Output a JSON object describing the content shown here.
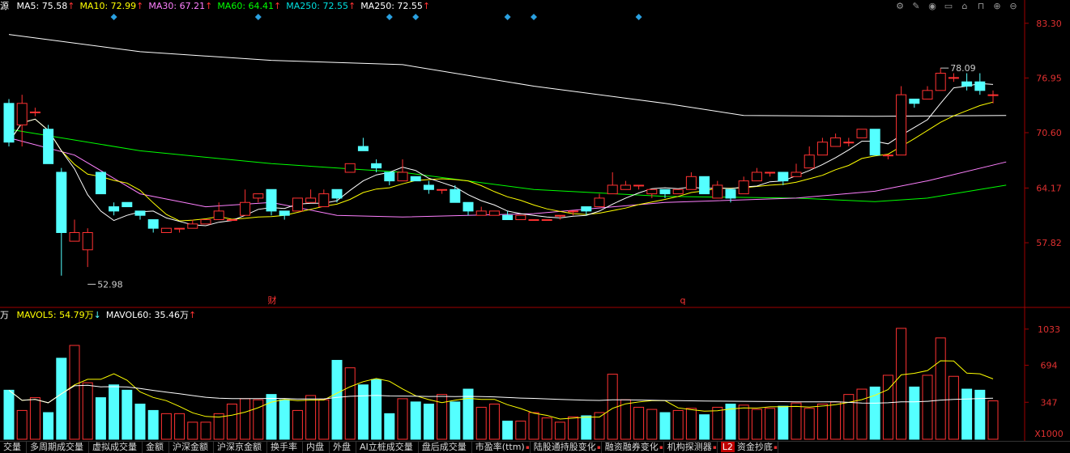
{
  "legend": {
    "name": "源",
    "items": [
      {
        "label": "MA5: 75.58",
        "arrow": "↑",
        "color": "#ffffff"
      },
      {
        "label": "MA10: 72.99",
        "arrow": "↑",
        "color": "#ffff00"
      },
      {
        "label": "MA30: 67.21",
        "arrow": "↑",
        "color": "#ff80ff"
      },
      {
        "label": "MA60: 64.41",
        "arrow": "↑",
        "color": "#00ff00"
      },
      {
        "label": "MA250: 72.55",
        "arrow": "↑",
        "color": "#00e0e0"
      },
      {
        "label": "MA250: 72.55",
        "arrow": "↑",
        "color": "#ffffff"
      }
    ]
  },
  "vol_legend": {
    "unit": "万",
    "items": [
      {
        "label": "MAVOL5: 54.79万",
        "arrow": "↓",
        "color": "#ffff00"
      },
      {
        "label": "MAVOL60: 35.46万",
        "arrow": "↑",
        "color": "#ffffff"
      }
    ]
  },
  "toolbar_icons": [
    "settings-icon",
    "pen-icon",
    "eye-icon",
    "basket-icon",
    "home-icon",
    "lock-icon",
    "plus-icon",
    "minus-icon"
  ],
  "price_axis": [
    "83.30",
    "76.95",
    "70.60",
    "64.17",
    "57.82"
  ],
  "vol_axis": [
    "1033",
    "694",
    "347",
    "X1000"
  ],
  "annotations": {
    "high": "78.09",
    "low": "52.98",
    "marker_cai": "财",
    "marker_q": "q"
  },
  "tabs": [
    {
      "label": "交量",
      "mark": false
    },
    {
      "label": "多周期成交量",
      "mark": false
    },
    {
      "label": "虚拟成交量",
      "mark": false
    },
    {
      "label": "金额",
      "mark": false
    },
    {
      "label": "沪深金额",
      "mark": false
    },
    {
      "label": "沪深京金额",
      "mark": false
    },
    {
      "label": "换手率",
      "mark": false
    },
    {
      "label": "内盘",
      "mark": false
    },
    {
      "label": "外盘",
      "mark": false
    },
    {
      "label": "AI立桩成交量",
      "mark": false
    },
    {
      "label": "盘后成交量",
      "mark": false
    },
    {
      "label": "市盈率(ttm)",
      "mark": true
    },
    {
      "label": "陆股通持股变化",
      "mark": true
    },
    {
      "label": "融资融券变化",
      "mark": true
    },
    {
      "label": "机构探测器",
      "mark": true
    },
    {
      "label": "资金抄底",
      "mark": true,
      "badge": "L2"
    }
  ],
  "colors": {
    "up": "#ff3232",
    "down": "#54ffff",
    "axis": "#a00000"
  },
  "chart_data": {
    "type": "candlestick",
    "price_range": [
      50.5,
      84.5
    ],
    "volume_range": [
      0,
      1100
    ],
    "candles": [
      [
        74,
        69.5,
        74.5,
        69
      ],
      [
        71.5,
        74,
        75,
        69
      ],
      [
        73,
        73,
        73.5,
        72.5
      ],
      [
        71,
        67,
        71.5,
        67
      ],
      [
        66,
        59,
        66.5,
        54
      ],
      [
        58,
        59,
        60.5,
        58
      ],
      [
        57,
        59,
        59.5,
        55
      ],
      [
        66,
        63.5,
        66,
        63.5
      ],
      [
        62,
        61.5,
        62.5,
        61
      ],
      [
        62.5,
        62,
        62.5,
        62
      ],
      [
        61.5,
        61,
        61.5,
        60.5
      ],
      [
        60.5,
        59.5,
        60.5,
        59
      ],
      [
        59,
        59.5,
        59.5,
        59
      ],
      [
        59.5,
        59.5,
        59.5,
        59
      ],
      [
        59.5,
        60,
        60.5,
        59.5
      ],
      [
        60,
        60.5,
        60.5,
        60
      ],
      [
        60.5,
        61.5,
        62.5,
        60.5
      ],
      [
        60.5,
        60.5,
        60.5,
        60.5
      ],
      [
        61,
        62.5,
        64,
        61
      ],
      [
        63,
        63.5,
        63.5,
        62.5
      ],
      [
        64,
        61.5,
        64,
        61
      ],
      [
        61.5,
        61,
        61.5,
        60.5
      ],
      [
        61.5,
        63,
        63,
        61.5
      ],
      [
        62.5,
        63,
        64,
        62.5
      ],
      [
        62,
        63.5,
        64,
        62
      ],
      [
        64,
        63,
        64,
        62.5
      ],
      [
        66,
        67,
        67,
        66
      ],
      [
        69,
        68.5,
        70,
        68.5
      ],
      [
        67,
        66.5,
        67.5,
        66
      ],
      [
        66,
        65,
        66,
        64.5
      ],
      [
        65,
        66,
        67.5,
        65
      ],
      [
        65.5,
        65,
        65.5,
        65
      ],
      [
        64.5,
        64,
        65,
        63.5
      ],
      [
        64,
        64,
        64,
        63.5
      ],
      [
        64,
        62.5,
        64.5,
        62.5
      ],
      [
        62.5,
        61.5,
        62.5,
        61
      ],
      [
        61,
        61.5,
        62,
        61
      ],
      [
        61,
        61.5,
        61.5,
        61
      ],
      [
        61,
        60.5,
        61.5,
        60.5
      ],
      [
        60.5,
        61,
        61,
        60.5
      ],
      [
        60.5,
        60.5,
        60.5,
        60.5
      ],
      [
        60.5,
        60.5,
        60.5,
        60.5
      ],
      [
        61,
        61,
        61,
        60.5
      ],
      [
        61.5,
        61.5,
        61.5,
        61
      ],
      [
        62,
        61.5,
        62,
        61
      ],
      [
        62,
        63,
        63.5,
        62
      ],
      [
        63.5,
        64.5,
        66,
        63.5
      ],
      [
        64,
        64.5,
        65,
        64
      ],
      [
        64.5,
        64.5,
        64.5,
        64
      ],
      [
        63.5,
        64,
        64,
        63
      ],
      [
        64,
        63.5,
        64,
        63
      ],
      [
        63.5,
        64,
        64,
        63.5
      ],
      [
        64,
        65.5,
        66,
        64
      ],
      [
        65.5,
        63.5,
        65.5,
        63.5
      ],
      [
        63,
        64.5,
        65,
        63
      ],
      [
        64,
        63,
        64,
        62.5
      ],
      [
        63.5,
        65,
        65.5,
        63.5
      ],
      [
        65,
        66,
        66.5,
        65
      ],
      [
        66,
        66,
        66,
        65.5
      ],
      [
        66,
        65,
        66,
        64.5
      ],
      [
        65.5,
        66,
        67,
        65.5
      ],
      [
        66.5,
        68,
        69,
        66.5
      ],
      [
        68,
        69.5,
        70,
        68
      ],
      [
        69,
        70,
        70.5,
        69
      ],
      [
        69.5,
        69.5,
        70,
        69
      ],
      [
        70,
        71,
        71,
        70
      ],
      [
        71,
        68,
        71,
        68
      ],
      [
        68,
        68,
        68,
        67.5
      ],
      [
        68,
        75,
        76,
        68
      ],
      [
        74.5,
        74,
        74.5,
        73.5
      ],
      [
        74.5,
        75.5,
        76,
        74.5
      ],
      [
        75.5,
        77.5,
        78.1,
        75.5
      ],
      [
        77,
        77,
        77.5,
        76.5
      ],
      [
        76.5,
        76,
        77.5,
        75.5
      ],
      [
        76.5,
        75.5,
        77.5,
        75
      ],
      [
        75,
        75,
        75.5,
        74
      ]
    ],
    "volumes": [
      460,
      270,
      390,
      250,
      760,
      880,
      530,
      390,
      510,
      460,
      330,
      270,
      240,
      240,
      160,
      160,
      240,
      330,
      380,
      370,
      420,
      370,
      270,
      410,
      370,
      740,
      670,
      510,
      560,
      240,
      380,
      350,
      330,
      420,
      350,
      470,
      300,
      330,
      170,
      170,
      250,
      200,
      160,
      210,
      220,
      250,
      610,
      370,
      300,
      280,
      250,
      270,
      290,
      230,
      300,
      330,
      320,
      280,
      290,
      310,
      340,
      290,
      330,
      350,
      420,
      470,
      490,
      600,
      1040,
      490,
      600,
      950,
      590,
      470,
      460,
      360
    ],
    "series": [
      {
        "name": "MA5",
        "color": "#ffffff"
      },
      {
        "name": "MA10",
        "color": "#ffff00"
      },
      {
        "name": "MA30",
        "color": "#ff80ff"
      },
      {
        "name": "MA60",
        "color": "#00ff00"
      },
      {
        "name": "MA250",
        "color": "#ffffff"
      }
    ],
    "ma250_line": [
      [
        0,
        82
      ],
      [
        10,
        80
      ],
      [
        20,
        79
      ],
      [
        30,
        78.5
      ],
      [
        40,
        76
      ],
      [
        50,
        74
      ],
      [
        56,
        72.6
      ],
      [
        66,
        72.5
      ],
      [
        76,
        72.6
      ]
    ],
    "ma60_line": [
      [
        0,
        71
      ],
      [
        10,
        68.5
      ],
      [
        20,
        67
      ],
      [
        30,
        66
      ],
      [
        40,
        64
      ],
      [
        50,
        63.2
      ],
      [
        60,
        63
      ],
      [
        66,
        62.6
      ],
      [
        70,
        63
      ],
      [
        76,
        64.5
      ]
    ],
    "ma30_line": [
      [
        0,
        70
      ],
      [
        5,
        68
      ],
      [
        10,
        63.5
      ],
      [
        15,
        62
      ],
      [
        20,
        62.5
      ],
      [
        25,
        61
      ],
      [
        30,
        60.8
      ],
      [
        40,
        61.2
      ],
      [
        50,
        62.5
      ],
      [
        60,
        63
      ],
      [
        66,
        63.8
      ],
      [
        70,
        65
      ],
      [
        76,
        67.2
      ]
    ],
    "diamonds_x": [
      8,
      19,
      29,
      31,
      38,
      40,
      48
    ]
  }
}
